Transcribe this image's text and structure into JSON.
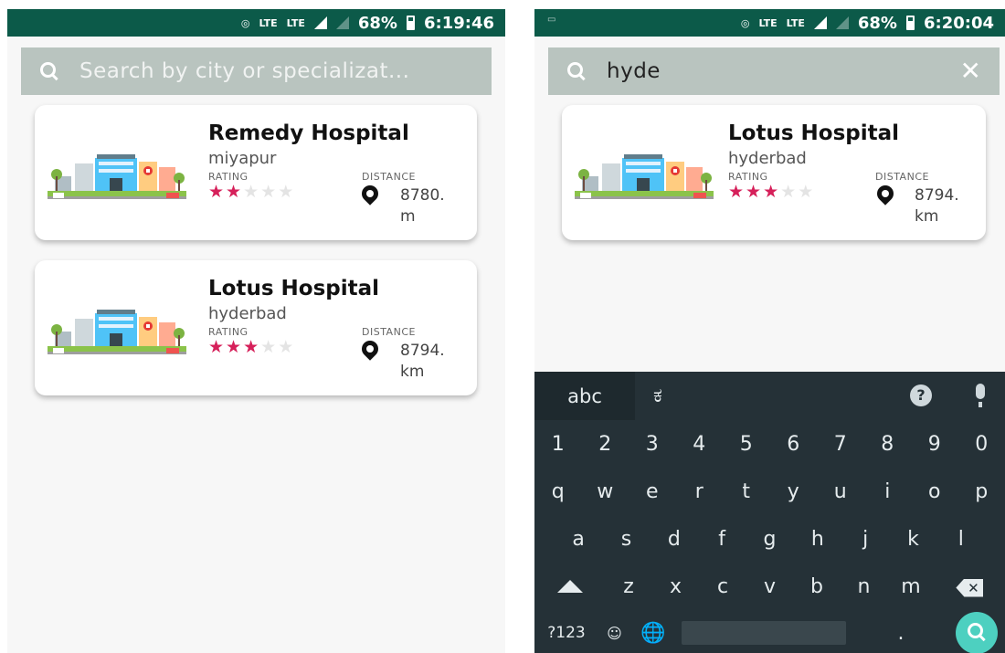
{
  "left": {
    "status": {
      "battery": "68%",
      "time": "6:19:46",
      "lte1": "LTE",
      "lte2": "LTE"
    },
    "search": {
      "text": "Search by city or specializat..."
    },
    "cards": [
      {
        "name": "Remedy Hospital",
        "city": "miyapur",
        "rating_label": "RATING",
        "distance_label": "DISTANCE",
        "distance_value": "8780.",
        "distance_unit": "m"
      },
      {
        "name": "Lotus Hospital",
        "city": "hyderbad",
        "rating_label": "RATING",
        "distance_label": "DISTANCE",
        "distance_value": "8794.",
        "distance_unit": "km"
      }
    ]
  },
  "right": {
    "status": {
      "battery": "68%",
      "time": "6:20:04",
      "lte1": "LTE",
      "lte2": "LTE"
    },
    "search": {
      "text": "hyde"
    },
    "cards": [
      {
        "name": "Lotus Hospital",
        "city": "hyderbad",
        "rating_label": "RATING",
        "distance_label": "DISTANCE",
        "distance_value": "8794.",
        "distance_unit": "km"
      }
    ],
    "keyboard": {
      "tab_label": "abc",
      "lang_key": "ಕ",
      "help_key": "?",
      "numbers": [
        "1",
        "2",
        "3",
        "4",
        "5",
        "6",
        "7",
        "8",
        "9",
        "0"
      ],
      "row1": [
        "q",
        "w",
        "e",
        "r",
        "t",
        "y",
        "u",
        "i",
        "o",
        "p"
      ],
      "row2": [
        "a",
        "s",
        "d",
        "f",
        "g",
        "h",
        "j",
        "k",
        "l"
      ],
      "row3": [
        "z",
        "x",
        "c",
        "v",
        "b",
        "n",
        "m"
      ],
      "symbols_key": "?123",
      "emoji_key": "☺",
      "globe_key": "🌐",
      "period_key": "."
    }
  },
  "ratings": {
    "remedy": 2,
    "lotus": 3,
    "max": 5
  },
  "colors": {
    "statusbar": "#0c5a49",
    "searchbar": "#b9c4bf",
    "star": "#d6205a",
    "keyboard": "#253137",
    "go_key": "#4dd0c0"
  }
}
